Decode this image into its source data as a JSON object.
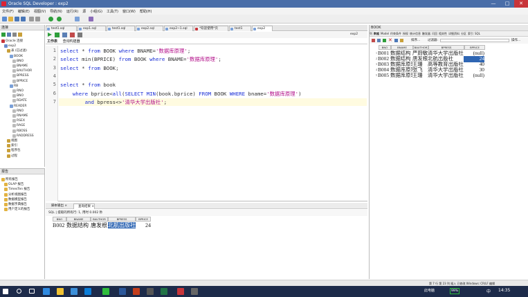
{
  "window": {
    "title": "Oracle SQL Developer : exp2",
    "min": "—",
    "max": "□",
    "close": "✕"
  },
  "menu": [
    "文件(F)",
    "编辑(E)",
    "视图(V)",
    "导航(N)",
    "运行(R)",
    "源",
    "小组(G)",
    "工具(T)",
    "窗口(W)",
    "帮助(H)"
  ],
  "left_panel": {
    "title": "连接",
    "tree": [
      {
        "label": "Oracle 连接",
        "indent": 0
      },
      {
        "label": "exp2",
        "indent": 1
      },
      {
        "label": "表 (已过滤)",
        "indent": 2
      },
      {
        "label": "BOOK",
        "indent": 3
      },
      {
        "label": "BNO",
        "indent": 4
      },
      {
        "label": "BNAME",
        "indent": 4
      },
      {
        "label": "BAUTHOR",
        "indent": 4
      },
      {
        "label": "BPRESS",
        "indent": 4
      },
      {
        "label": "BPRICE",
        "indent": 4
      },
      {
        "label": "RB",
        "indent": 3
      },
      {
        "label": "RNO",
        "indent": 4
      },
      {
        "label": "BNO",
        "indent": 4
      },
      {
        "label": "RDATE",
        "indent": 4
      },
      {
        "label": "READER",
        "indent": 3
      },
      {
        "label": "RNO",
        "indent": 4
      },
      {
        "label": "RNAME",
        "indent": 4
      },
      {
        "label": "RSEX",
        "indent": 4
      },
      {
        "label": "RAGE",
        "indent": 4
      },
      {
        "label": "RBOSS",
        "indent": 4
      },
      {
        "label": "RADDRESS",
        "indent": 4
      },
      {
        "label": "视图",
        "indent": 2
      },
      {
        "label": "索引",
        "indent": 2
      },
      {
        "label": "程序包",
        "indent": 2
      },
      {
        "label": "过程",
        "indent": 2
      }
    ]
  },
  "reports_panel": {
    "title": "报告",
    "items": [
      "所有报告",
      "OLAP 报告",
      "TimesTen 报告",
      "分析视图报告",
      "数据模型报告",
      "数据字典报告",
      "用户定义的报告"
    ]
  },
  "tabs": [
    "test1.sql",
    "exp1.sql",
    "test1.sql",
    "exp2.sql",
    "exp2~1.sql",
    "*欢迎使用*页",
    "test1",
    "exp2"
  ],
  "subtabs": [
    "工作表",
    "查询构建器"
  ],
  "editor": {
    "lines": [
      [
        [
          "kw",
          "select"
        ],
        [
          "t",
          " * "
        ],
        [
          "kw",
          "from"
        ],
        [
          "t",
          " BOOK "
        ],
        [
          "kw",
          "where"
        ],
        [
          "t",
          " BNAME="
        ],
        [
          "str",
          "'数据库原理'"
        ],
        [
          "t",
          ";"
        ]
      ],
      [
        [
          "kw",
          "select"
        ],
        [
          "t",
          " min(BPRICE) "
        ],
        [
          "kw",
          "from"
        ],
        [
          "t",
          " BOOK "
        ],
        [
          "kw",
          "where"
        ],
        [
          "t",
          " BNAME="
        ],
        [
          "str",
          "'数据库原理'"
        ],
        [
          "t",
          ";"
        ]
      ],
      [
        [
          "kw",
          "select"
        ],
        [
          "t",
          " * "
        ],
        [
          "kw",
          "from"
        ],
        [
          "t",
          " BOOK;"
        ]
      ],
      [
        [
          "t",
          ""
        ]
      ],
      [
        [
          "kw",
          "select"
        ],
        [
          "t",
          " * "
        ],
        [
          "kw",
          "from"
        ],
        [
          "t",
          " book"
        ]
      ],
      [
        [
          "t",
          "    "
        ],
        [
          "kw",
          "where"
        ],
        [
          "t",
          " bprice<"
        ],
        [
          "kw",
          "all"
        ],
        [
          "t",
          "("
        ],
        [
          "kw",
          "SELECT"
        ],
        [
          "t",
          " "
        ],
        [
          "kw",
          "MIN"
        ],
        [
          "t",
          "(book.bprice) "
        ],
        [
          "kw",
          "FROM"
        ],
        [
          "t",
          " BOOK "
        ],
        [
          "kw",
          "WHERE"
        ],
        [
          "t",
          " bname="
        ],
        [
          "str",
          "'数据库原理'"
        ],
        [
          "t",
          ")"
        ]
      ],
      [
        [
          "t",
          "        "
        ],
        [
          "kw",
          "and"
        ],
        [
          "t",
          " bpress<>"
        ],
        [
          "str",
          "'清华大学出版社'"
        ],
        [
          "t",
          ";"
        ]
      ]
    ],
    "line_numbers": [
      "1",
      "2",
      "3",
      "4",
      "5",
      "6",
      "7"
    ],
    "current_line": 7
  },
  "results": {
    "tab1": "脚本输出 ×",
    "tab2": "查询结果 ×",
    "info": "SQL | 提取的所有行: 1, 用时 0.002 秒",
    "headers": [
      "BNO",
      "BNAME",
      "BAUTHOR",
      "BPRESS",
      "BPRICE"
    ],
    "row": [
      "B002",
      "数据结构",
      "唐发根",
      "北航出版社",
      "24"
    ],
    "selected_col": 3
  },
  "right_panel": {
    "title": "BOOK",
    "tabs": [
      "列",
      "数据",
      "Model",
      "约束条件",
      "授权",
      "统计信息",
      "触发器",
      "闪回",
      "相关性",
      "详细资料",
      "分区",
      "索引",
      "SQL"
    ],
    "filter_label": "过滤器:",
    "sort_label": "排序...",
    "action_label": "操作...",
    "headers": [
      "BNO",
      "BNAME",
      "BAUTHOR",
      "BPRESS",
      "BPRICE"
    ],
    "rows": [
      [
        "1",
        "B001",
        "数据结构",
        "严蔚敏",
        "清华大学出版社",
        "(null)"
      ],
      [
        "2",
        "B002",
        "数据结构",
        "唐发根",
        "北航出版社",
        "24"
      ],
      [
        "3",
        "B003",
        "数据库原理",
        "王珊",
        "高等教育出版社",
        "40"
      ],
      [
        "4",
        "B004",
        "数据库原理",
        "张飞",
        "清华大学出版社",
        "30"
      ],
      [
        "5",
        "B005",
        "数据库原理",
        "王珊",
        "清华大学出版社",
        "(null)"
      ]
    ],
    "selected_row": 1
  },
  "status": {
    "right": "第 7 行 第 23 列 插入 已修改 Windows: CR/LF 编辑"
  },
  "taskbar": {
    "computer": "此电脑",
    "battery": "99%",
    "lang": "中",
    "time": "14:35"
  }
}
